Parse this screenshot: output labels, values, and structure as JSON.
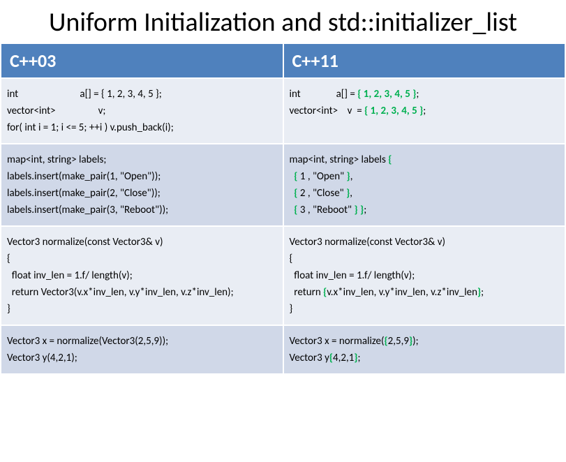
{
  "title": "Uniform Initialization and std::initializer_list",
  "headers": {
    "left": "C++03",
    "right": "C++11"
  },
  "rows": [
    {
      "left": [
        {
          "t": "int                          a[] = { 1, 2, 3, 4, 5 };"
        },
        {
          "t": "vector<int>                  v;"
        },
        {
          "t": "for( int i = 1; i <= 5; ++i ) v.push_back(i);"
        }
      ],
      "right": [
        {
          "t": "int               a[] = "
        },
        {
          "t": "{ 1, 2, 3, 4, 5 }",
          "hl": true
        },
        {
          "t": ";"
        },
        {
          "br": true
        },
        {
          "t": "vector<int>    v  = "
        },
        {
          "t": "{ 1, 2, 3, 4, 5 }",
          "hl": true
        },
        {
          "t": ";"
        }
      ]
    },
    {
      "left": [
        {
          "t": "map<int, string> labels;"
        },
        {
          "t": "labels.insert(make_pair(1, \"Open\"));"
        },
        {
          "t": "labels.insert(make_pair(2, \"Close\"));"
        },
        {
          "t": "labels.insert(make_pair(3, \"Reboot\"));"
        }
      ],
      "right": [
        {
          "t": "map<int, string> labels "
        },
        {
          "t": "{",
          "hl": true
        },
        {
          "br": true
        },
        {
          "t": "  "
        },
        {
          "t": "{",
          "hl": true
        },
        {
          "t": " 1 , \"Open\" "
        },
        {
          "t": "}",
          "hl": true
        },
        {
          "t": ","
        },
        {
          "br": true
        },
        {
          "t": "  "
        },
        {
          "t": "{",
          "hl": true
        },
        {
          "t": " 2 , \"Close\" "
        },
        {
          "t": "}",
          "hl": true
        },
        {
          "t": ","
        },
        {
          "br": true
        },
        {
          "t": "  "
        },
        {
          "t": "{",
          "hl": true
        },
        {
          "t": " 3 , \"Reboot\" "
        },
        {
          "t": "} }",
          "hl": true
        },
        {
          "t": ";"
        }
      ]
    },
    {
      "left": [
        {
          "t": "Vector3 normalize(const Vector3& v)"
        },
        {
          "t": "{"
        },
        {
          "t": "  float inv_len = 1.f/ length(v);"
        },
        {
          "t": "  return Vector3(v.x*inv_len, v.y*inv_len, v.z*inv_len);"
        },
        {
          "t": "}"
        }
      ],
      "right": [
        {
          "t": "Vector3 normalize(const Vector3& v)"
        },
        {
          "br": true
        },
        {
          "t": "{"
        },
        {
          "br": true
        },
        {
          "t": "  float inv_len = 1.f/ length(v);"
        },
        {
          "br": true
        },
        {
          "t": "  return "
        },
        {
          "t": "{",
          "hl": true
        },
        {
          "t": "v.x*inv_len, v.y*inv_len, v.z*inv_len"
        },
        {
          "t": "}",
          "hl": true
        },
        {
          "t": ";"
        },
        {
          "br": true
        },
        {
          "t": "}"
        }
      ]
    },
    {
      "left": [
        {
          "t": "Vector3 x = normalize(Vector3(2,5,9));"
        },
        {
          "t": "Vector3 y(4,2,1);"
        }
      ],
      "right": [
        {
          "t": "Vector3 x = normalize("
        },
        {
          "t": "{",
          "hl": true
        },
        {
          "t": "2,5,9"
        },
        {
          "t": "}",
          "hl": true
        },
        {
          "t": ");"
        },
        {
          "br": true
        },
        {
          "t": "Vector3 y"
        },
        {
          "t": "{",
          "hl": true
        },
        {
          "t": "4,2,1"
        },
        {
          "t": "}",
          "hl": true
        },
        {
          "t": ";"
        }
      ]
    }
  ]
}
